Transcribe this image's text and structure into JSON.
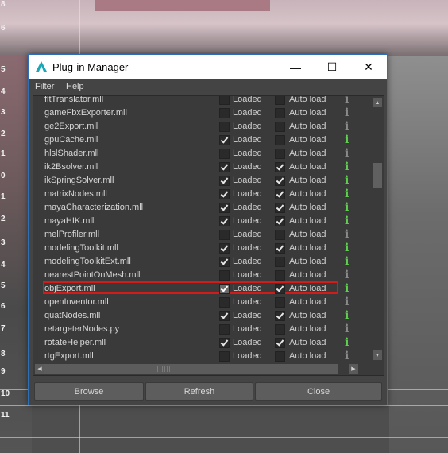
{
  "viewport": {
    "row_numbers": [
      "8",
      "6",
      "5",
      "4",
      "3",
      "2",
      "1",
      "0",
      "1",
      "2",
      "3",
      "4",
      "5",
      "6",
      "7",
      "8",
      "9",
      "10",
      "11"
    ]
  },
  "dialog": {
    "title": "Plug-in Manager",
    "minimize_glyph": "—",
    "maximize_glyph": "☐",
    "close_glyph": "✕",
    "menu": [
      "Filter",
      "Help"
    ],
    "loaded_label": "Loaded",
    "autoload_label": "Auto load",
    "info_glyph": "i",
    "plugins": [
      {
        "name": "fltTranslator.mll",
        "loaded": false,
        "autoload": false
      },
      {
        "name": "gameFbxExporter.mll",
        "loaded": false,
        "autoload": false
      },
      {
        "name": "ge2Export.mll",
        "loaded": false,
        "autoload": false
      },
      {
        "name": "gpuCache.mll",
        "loaded": true,
        "autoload": false
      },
      {
        "name": "hlslShader.mll",
        "loaded": false,
        "autoload": false
      },
      {
        "name": "ik2Bsolver.mll",
        "loaded": true,
        "autoload": true
      },
      {
        "name": "ikSpringSolver.mll",
        "loaded": true,
        "autoload": true
      },
      {
        "name": "matrixNodes.mll",
        "loaded": true,
        "autoload": true
      },
      {
        "name": "mayaCharacterization.mll",
        "loaded": true,
        "autoload": true
      },
      {
        "name": "mayaHIK.mll",
        "loaded": true,
        "autoload": true
      },
      {
        "name": "melProfiler.mll",
        "loaded": false,
        "autoload": false
      },
      {
        "name": "modelingToolkit.mll",
        "loaded": true,
        "autoload": true
      },
      {
        "name": "modelingToolkitExt.mll",
        "loaded": true,
        "autoload": false
      },
      {
        "name": "nearestPointOnMesh.mll",
        "loaded": false,
        "autoload": false
      },
      {
        "name": "objExport.mll",
        "loaded": true,
        "autoload": true,
        "highlighted": true
      },
      {
        "name": "openInventor.mll",
        "loaded": false,
        "autoload": false
      },
      {
        "name": "quatNodes.mll",
        "loaded": true,
        "autoload": true
      },
      {
        "name": "retargeterNodes.py",
        "loaded": false,
        "autoload": false
      },
      {
        "name": "rotateHelper.mll",
        "loaded": true,
        "autoload": true
      },
      {
        "name": "rtgExport.mll",
        "loaded": false,
        "autoload": false
      }
    ],
    "buttons": {
      "browse": "Browse",
      "refresh": "Refresh",
      "close": "Close"
    },
    "scroll_up": "▲",
    "scroll_down": "▼",
    "scroll_left": "◀",
    "scroll_right": "▶",
    "colors": {
      "accent_border": "#2f6fb6",
      "selection_outline": "#d21b1b",
      "info_active": "#5fcf4f",
      "info_inactive": "#8a8a8a"
    }
  }
}
